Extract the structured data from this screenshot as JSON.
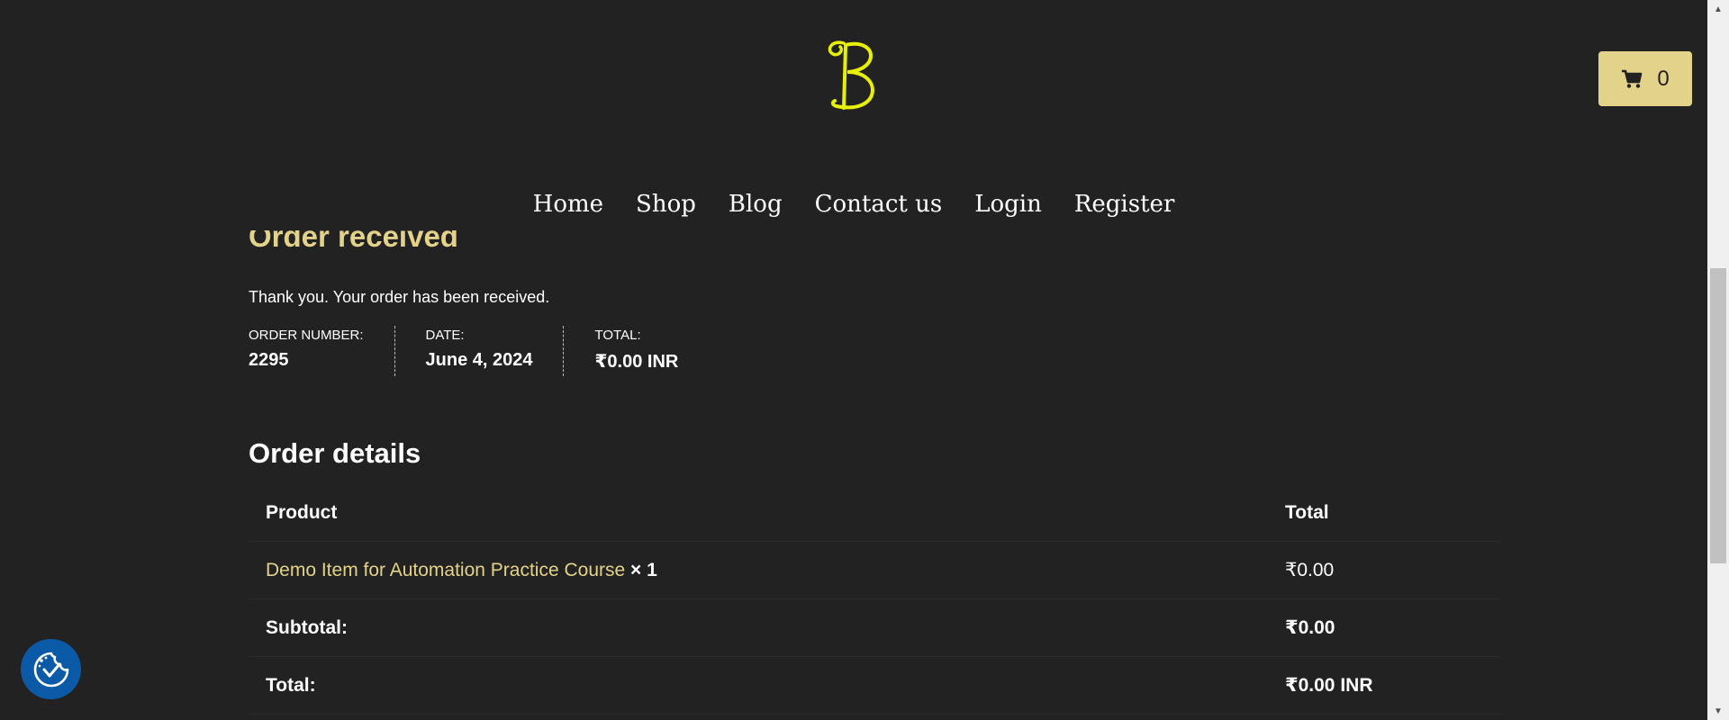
{
  "header": {
    "logo_alt": "B",
    "cart": {
      "icon": "cart-icon",
      "count": "0"
    },
    "nav": [
      "Home",
      "Shop",
      "Blog",
      "Contact us",
      "Login",
      "Register"
    ]
  },
  "order": {
    "title": "Order received",
    "thankyou": "Thank you. Your order has been received.",
    "overview": [
      {
        "label": "ORDER NUMBER:",
        "value": "2295"
      },
      {
        "label": "DATE:",
        "value": "June 4, 2024"
      },
      {
        "label": "TOTAL:",
        "value": "₹0.00 INR"
      }
    ]
  },
  "details": {
    "title": "Order details",
    "headers": {
      "product": "Product",
      "total": "Total"
    },
    "item": {
      "name": "Demo Item for Automation Practice Course",
      "qty": "× 1",
      "total": "₹0.00"
    },
    "subtotal": {
      "label": "Subtotal:",
      "value": "₹0.00"
    },
    "total": {
      "label": "Total:",
      "value": "₹0.00 INR"
    }
  },
  "colors": {
    "background": "#222222",
    "accent": "#e3d28a",
    "logo": "#e6f000",
    "cookie_badge": "#0b5aa8"
  },
  "cookie_badge": {
    "icon": "cookie-consent-icon"
  }
}
